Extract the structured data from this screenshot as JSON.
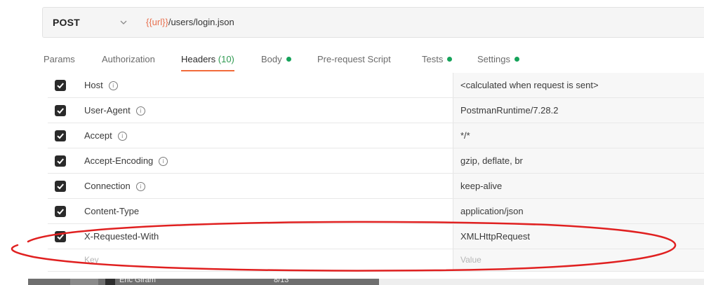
{
  "request": {
    "method": "POST",
    "url_var": "{{url}}",
    "url_path": "/users/login.json"
  },
  "tabs": [
    {
      "label": "Params",
      "count": "",
      "dot": false,
      "active": false
    },
    {
      "label": "Authorization",
      "count": "",
      "dot": false,
      "active": false
    },
    {
      "label": "Headers",
      "count": "(10)",
      "dot": false,
      "active": true
    },
    {
      "label": "Body",
      "count": "",
      "dot": true,
      "active": false
    },
    {
      "label": "Pre-request Script",
      "count": "",
      "dot": false,
      "active": false
    },
    {
      "label": "Tests",
      "count": "",
      "dot": true,
      "active": false
    },
    {
      "label": "Settings",
      "count": "",
      "dot": true,
      "active": false
    }
  ],
  "headers": [
    {
      "key": "Host",
      "value": "<calculated when request is sent>",
      "checked": true,
      "info": true
    },
    {
      "key": "User-Agent",
      "value": "PostmanRuntime/7.28.2",
      "checked": true,
      "info": true
    },
    {
      "key": "Accept",
      "value": "*/*",
      "checked": true,
      "info": true
    },
    {
      "key": "Accept-Encoding",
      "value": "gzip, deflate, br",
      "checked": true,
      "info": true
    },
    {
      "key": "Connection",
      "value": "keep-alive",
      "checked": true,
      "info": true
    },
    {
      "key": "Content-Type",
      "value": "application/json",
      "checked": true,
      "info": false
    },
    {
      "key": "X-Requested-With",
      "value": "XMLHttpRequest",
      "checked": true,
      "info": false
    }
  ],
  "new_row": {
    "key_placeholder": "Key",
    "value_placeholder": "Value"
  },
  "bottom_strip": {
    "left_text": "Eric Giram",
    "right_text": "8/13"
  },
  "colors": {
    "accent": "#f26b3a",
    "dot_green": "#15a35a",
    "url_var": "#e8704f",
    "annotation": "#e02020"
  },
  "icons": {
    "method_dropdown": "chevron-down-icon",
    "info": "info-icon",
    "checkbox": "checkmark-icon"
  }
}
